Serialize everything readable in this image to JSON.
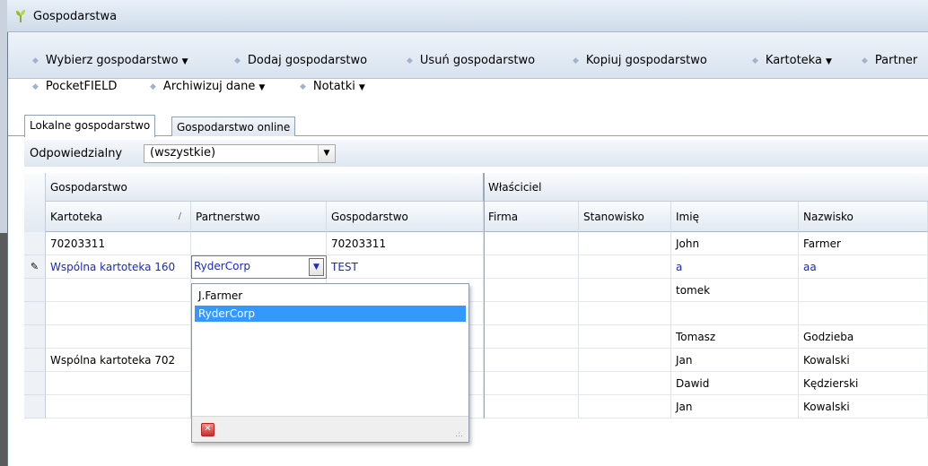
{
  "window": {
    "title": "Gospodarstwa"
  },
  "toolbar": {
    "row1": [
      {
        "label": "Wybierz gospodarstwo",
        "dropdown": true
      },
      {
        "label": "Dodaj gospodarstwo",
        "dropdown": false
      },
      {
        "label": "Usuń gospodarstwo",
        "dropdown": false
      },
      {
        "label": "Kopiuj gospodarstwo",
        "dropdown": false
      },
      {
        "label": "Kartoteka",
        "dropdown": true
      },
      {
        "label": "Partner",
        "dropdown": false
      }
    ],
    "row2": [
      {
        "label": "PocketFIELD",
        "dropdown": false
      },
      {
        "label": "Archiwizuj dane",
        "dropdown": true
      },
      {
        "label": "Notatki",
        "dropdown": true
      }
    ],
    "arrow": "▼"
  },
  "tabs": [
    {
      "label": "Lokalne gospodarstwo",
      "active": true
    },
    {
      "label": "Gospodarstwo online",
      "active": false
    }
  ],
  "filter": {
    "label": "Odpowiedzialny",
    "value": "(wszystkie)"
  },
  "grid": {
    "band_left": "Gospodarstwo",
    "band_right": "Właściciel",
    "columns": [
      "Kartoteka",
      "Partnerstwo",
      "Gospodarstwo",
      "Firma",
      "Stanowisko",
      "Imię",
      "Nazwisko"
    ],
    "sort_glyph": "/",
    "rows": [
      [
        "70203311",
        "",
        "70203311",
        "",
        "",
        "John",
        "Farmer"
      ],
      [
        "Wspólna kartoteka 160",
        "RyderCorp",
        "TEST",
        "",
        "",
        "a",
        "aa"
      ],
      [
        "",
        "",
        "",
        "",
        "",
        "tomek",
        ""
      ],
      [
        "",
        "",
        "",
        "",
        "",
        "",
        ""
      ],
      [
        "",
        "",
        "",
        "",
        "",
        "Tomasz",
        "Godzieba"
      ],
      [
        "Wspólna kartoteka 702",
        "",
        "",
        "",
        "",
        "Jan",
        "Kowalski"
      ],
      [
        "",
        "",
        "",
        "",
        "",
        "Dawid",
        "Kędzierski"
      ],
      [
        "",
        "",
        "",
        "",
        "",
        "Jan",
        "Kowalski"
      ]
    ],
    "edit_row_index": 1,
    "edit_glyph": "✎"
  },
  "partner_dropdown": {
    "options": [
      "J.Farmer",
      "RyderCorp"
    ],
    "selected": "RyderCorp"
  },
  "colors": {
    "accent_blue": "#1a29c7",
    "selection": "#3399ff"
  }
}
